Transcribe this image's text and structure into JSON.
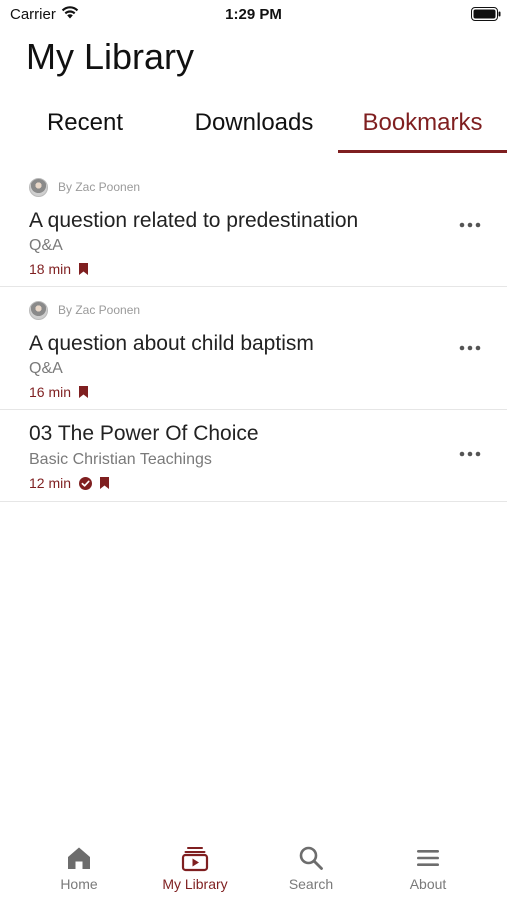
{
  "status_bar": {
    "carrier": "Carrier",
    "time": "1:29 PM"
  },
  "page": {
    "title": "My Library"
  },
  "tabs": [
    {
      "label": "Recent",
      "active": false
    },
    {
      "label": "Downloads",
      "active": false
    },
    {
      "label": "Bookmarks",
      "active": true
    }
  ],
  "items": [
    {
      "author": "By Zac Poonen",
      "title": "A question related to predestination",
      "subtitle": "Q&A",
      "duration": "18 min",
      "bookmarked": true,
      "downloaded": false
    },
    {
      "author": "By Zac Poonen",
      "title": "A question about child baptism",
      "subtitle": "Q&A",
      "duration": "16 min",
      "bookmarked": true,
      "downloaded": false
    },
    {
      "title": "03 The Power Of Choice",
      "subtitle": "Basic Christian Teachings",
      "duration": "12 min",
      "bookmarked": true,
      "downloaded": true
    }
  ],
  "tab_bar": [
    {
      "label": "Home",
      "icon": "home-icon"
    },
    {
      "label": "My Library",
      "icon": "library-icon",
      "active": true
    },
    {
      "label": "Search",
      "icon": "search-icon"
    },
    {
      "label": "About",
      "icon": "menu-icon"
    }
  ],
  "colors": {
    "accent": "#7f1f20",
    "text": "#222222",
    "secondary": "#7a7a7a",
    "inactive_tab": "#7a7a7a"
  }
}
